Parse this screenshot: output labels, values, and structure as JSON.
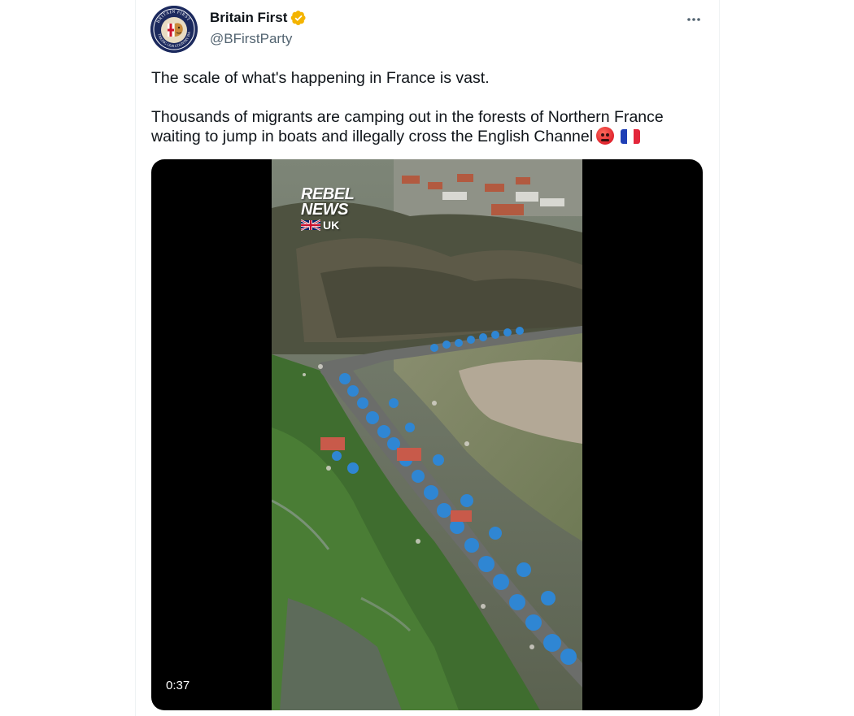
{
  "author": {
    "display_name": "Britain First",
    "handle": "@BFirstParty",
    "verified_badge_color": "#f4b400",
    "avatar_icon": "britain-first-logo-icon",
    "avatar_text": "BRITAIN FIRST · TAKING OUR COUNTRY BACK"
  },
  "more_icon": "more-dots-icon",
  "tweet": {
    "paragraph_1": "The scale of what's happening in France is vast.",
    "paragraph_2": "Thousands of migrants are camping out in the forests of Northern France waiting to jump in boats and illegally cross the English Channel",
    "emoji_1": "angry-face-emoji",
    "emoji_2": "france-flag-emoji"
  },
  "media": {
    "watermark_line1": "REBEL",
    "watermark_line2": "NEWS",
    "watermark_uk": "UK",
    "duration": "0:37"
  },
  "colors": {
    "text_primary": "#0f1419",
    "text_secondary": "#536471",
    "border": "#eff3f4"
  }
}
